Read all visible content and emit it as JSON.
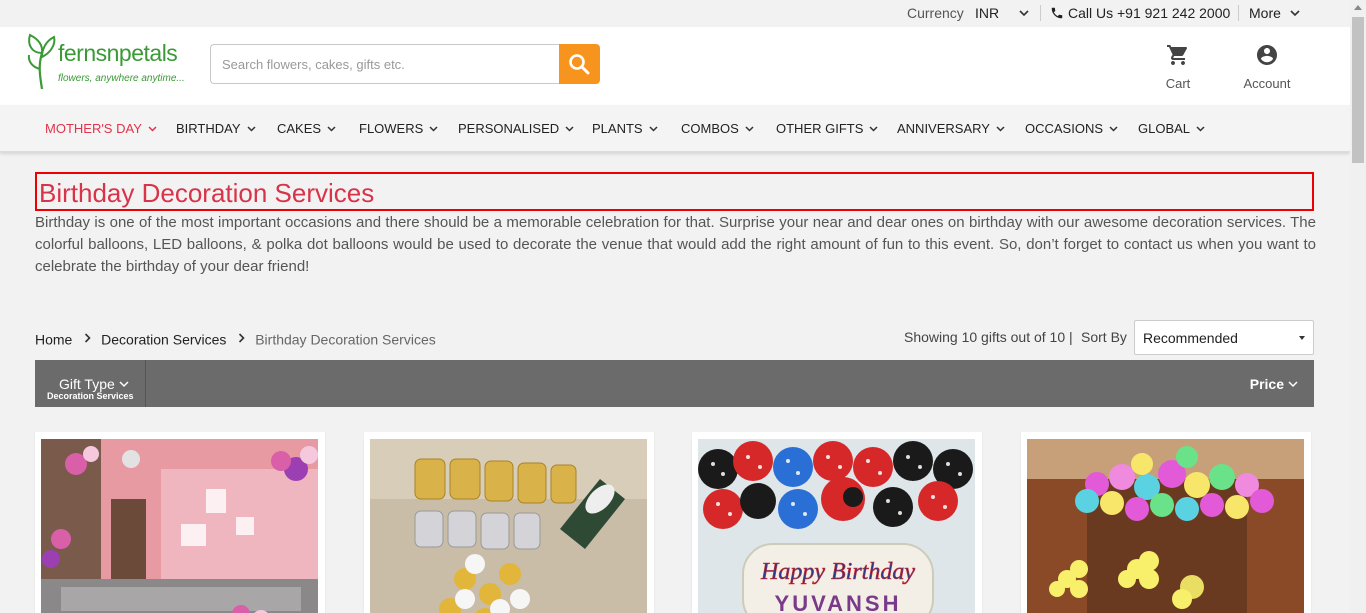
{
  "topbar": {
    "currency_label": "Currency",
    "currency_value": "INR",
    "call_text": "Call Us +91 921 242 2000",
    "more_label": "More"
  },
  "header": {
    "logo_text": "fernsnpetals",
    "logo_tagline": "flowers, anywhere anytime...",
    "search_placeholder": "Search flowers, cakes, gifts etc.",
    "cart_label": "Cart",
    "account_label": "Account"
  },
  "nav": {
    "items": [
      {
        "label": "MOTHER'S DAY"
      },
      {
        "label": "BIRTHDAY"
      },
      {
        "label": "CAKES"
      },
      {
        "label": "FLOWERS"
      },
      {
        "label": "PERSONALISED"
      },
      {
        "label": "PLANTS"
      },
      {
        "label": "COMBOS"
      },
      {
        "label": "OTHER GIFTS"
      },
      {
        "label": "ANNIVERSARY"
      },
      {
        "label": "OCCASIONS"
      },
      {
        "label": "GLOBAL"
      }
    ]
  },
  "page": {
    "title": "Birthday Decoration Services",
    "description": "Birthday is one of the most important occasions and there should be a memorable celebration for that. Surprise your near and dear ones on birthday with our awesome decoration services. The colorful balloons, LED balloons, & polka dot balloons would be used to decorate the venue that would add the right amount of fun to this event. So, don’t forget to contact us when you want to celebrate the birthday of your dear friend!"
  },
  "breadcrumb": {
    "home": "Home",
    "category": "Decoration Services",
    "current": "Birthday Decoration Services"
  },
  "listing": {
    "showing_text": "Showing 10 gifts out of 10 |",
    "sort_label": "Sort By",
    "sort_value": "Recommended"
  },
  "filters": {
    "gift_type_label": "Gift Type",
    "gift_type_value": "Decoration Services",
    "price_label": "Price"
  },
  "products": [
    {
      "image": "pink-room-balloon-decoration"
    },
    {
      "image": "happy-bday-gold-balloons"
    },
    {
      "image": "polka-dot-balloon-flowers",
      "banner_text_1": "Happy Birthday",
      "banner_text_2": "YUVANSH"
    },
    {
      "image": "led-balloons-ceiling"
    }
  ],
  "colors": {
    "accent_red": "#d9334a",
    "search_button": "#f7941d",
    "filter_bar": "#6b6b6b",
    "brand_green": "#3a9a35"
  }
}
